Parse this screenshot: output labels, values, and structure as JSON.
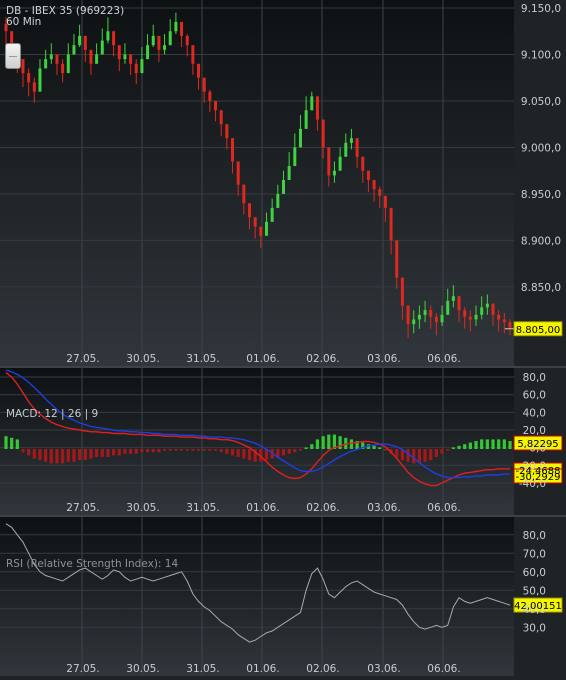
{
  "header": {
    "title": "DB - IBEX 35 (969223)",
    "interval": "60 Min"
  },
  "chart_data": [
    {
      "type": "candlestick",
      "title": "DB - IBEX 35 (969223)",
      "subtitle": "60 Min",
      "x_ticks": [
        "27.05.",
        "30.05.",
        "31.05.",
        "01.06.",
        "02.06.",
        "03.06.",
        "06.06."
      ],
      "y_ticks": [
        "9.150,0",
        "9.100,0",
        "9.050,0",
        "9.000,0",
        "8.950,0",
        "8.900,0",
        "8.850,0"
      ],
      "ylim": [
        8780,
        9150
      ],
      "last_value_label": "8.805,00",
      "last_value": 8805,
      "up_color": "#3fd33f",
      "down_color": "#e0281e",
      "close": [
        9125,
        9110,
        9095,
        9080,
        9070,
        9060,
        9085,
        9095,
        9100,
        9090,
        9080,
        9100,
        9110,
        9120,
        9105,
        9090,
        9100,
        9115,
        9125,
        9110,
        9095,
        9100,
        9090,
        9080,
        9095,
        9110,
        9120,
        9105,
        9110,
        9125,
        9135,
        9120,
        9110,
        9090,
        9075,
        9060,
        9050,
        9040,
        9025,
        9010,
        8985,
        8960,
        8940,
        8925,
        8915,
        8905,
        8920,
        8935,
        8950,
        8965,
        8980,
        9000,
        9020,
        9040,
        9055,
        9030,
        9000,
        8970,
        8975,
        8990,
        9005,
        9010,
        8990,
        8975,
        8965,
        8955,
        8948,
        8935,
        8900,
        8860,
        8830,
        8810,
        8815,
        8820,
        8825,
        8818,
        8812,
        8820,
        8835,
        8840,
        8825,
        8818,
        8815,
        8820,
        8828,
        8832,
        8820,
        8815,
        8812,
        8806
      ],
      "wick_high": [
        9140,
        9125,
        9110,
        9095,
        9085,
        9075,
        9095,
        9105,
        9112,
        9100,
        9095,
        9112,
        9122,
        9132,
        9118,
        9100,
        9112,
        9128,
        9140,
        9122,
        9108,
        9112,
        9100,
        9095,
        9108,
        9122,
        9132,
        9118,
        9122,
        9138,
        9145,
        9132,
        9122,
        9100,
        9085,
        9072,
        9062,
        9050,
        9035,
        9020,
        8995,
        8970,
        8950,
        8932,
        8922,
        8915,
        8930,
        8945,
        8960,
        8975,
        8995,
        9015,
        9035,
        9055,
        9060,
        9040,
        9012,
        8982,
        8985,
        9000,
        9015,
        9020,
        9002,
        8985,
        8975,
        8965,
        8958,
        8945,
        8910,
        8870,
        8842,
        8822,
        8825,
        8830,
        8835,
        8830,
        8822,
        8830,
        8848,
        8852,
        8838,
        8828,
        8825,
        8830,
        8840,
        8842,
        8830,
        8825,
        8822,
        8815
      ],
      "wick_low": [
        9108,
        9095,
        9080,
        9065,
        9055,
        9048,
        9070,
        9085,
        9090,
        9078,
        9070,
        9088,
        9100,
        9108,
        9092,
        9078,
        9090,
        9102,
        9112,
        9098,
        9082,
        9090,
        9078,
        9068,
        9082,
        9098,
        9108,
        9092,
        9100,
        9112,
        9122,
        9108,
        9098,
        9078,
        9062,
        9048,
        9038,
        9028,
        9012,
        8998,
        8972,
        8948,
        8928,
        8912,
        8902,
        8892,
        8908,
        8925,
        8940,
        8955,
        8970,
        8988,
        9008,
        9028,
        9042,
        9018,
        8988,
        8958,
        8962,
        8978,
        8992,
        8998,
        8978,
        8962,
        8952,
        8942,
        8935,
        8920,
        8885,
        8848,
        8815,
        8795,
        8800,
        8805,
        8812,
        8805,
        8798,
        8808,
        8822,
        8828,
        8812,
        8805,
        8802,
        8808,
        8815,
        8820,
        8808,
        8802,
        8800,
        8798
      ]
    },
    {
      "type": "line",
      "title": "MACD: 12 | 26 | 9",
      "y_ticks": [
        "80,0",
        "60,0",
        "40,0",
        "20,0",
        "0,0",
        "-20,0",
        "-40,0"
      ],
      "ylim": [
        -48,
        88
      ],
      "value_labels": [
        "5,82295",
        "-24,4688",
        "-30,2929"
      ],
      "series": [
        {
          "color": "#e02020",
          "values": [
            85,
            80,
            72,
            62,
            52,
            44,
            38,
            33,
            29,
            26,
            24,
            22,
            21,
            20,
            19,
            18,
            18,
            17,
            17,
            16,
            16,
            16,
            15,
            15,
            15,
            14,
            14,
            14,
            13,
            13,
            13,
            12,
            12,
            12,
            11,
            11,
            10,
            10,
            9,
            9,
            8,
            6,
            3,
            0,
            -5,
            -10,
            -16,
            -22,
            -27,
            -31,
            -34,
            -35,
            -34,
            -30,
            -24,
            -16,
            -9,
            -3,
            0,
            2,
            4,
            5,
            6,
            7,
            7,
            6,
            4,
            1,
            -5,
            -12,
            -20,
            -28,
            -34,
            -38,
            -41,
            -43,
            -43,
            -40,
            -37,
            -34,
            -31,
            -29,
            -28,
            -27,
            -26,
            -25,
            -25,
            -24,
            -24,
            -24
          ]
        },
        {
          "color": "#1e3ee0",
          "values": [
            88,
            86,
            83,
            79,
            74,
            68,
            62,
            55,
            49,
            43,
            38,
            34,
            31,
            28,
            26,
            24,
            23,
            22,
            21,
            20,
            19,
            19,
            18,
            18,
            17,
            17,
            16,
            16,
            15,
            15,
            15,
            14,
            14,
            14,
            13,
            13,
            12,
            12,
            12,
            11,
            11,
            10,
            9,
            7,
            5,
            2,
            -2,
            -6,
            -11,
            -15,
            -19,
            -23,
            -26,
            -27,
            -27,
            -25,
            -22,
            -18,
            -14,
            -10,
            -7,
            -4,
            -2,
            0,
            2,
            3,
            4,
            4,
            3,
            1,
            -2,
            -7,
            -12,
            -17,
            -22,
            -26,
            -30,
            -32,
            -34,
            -34,
            -34,
            -33,
            -33,
            -32,
            -32,
            -31,
            -31,
            -31,
            -30,
            -30
          ]
        }
      ],
      "histogram": {
        "up_color": "#34c934",
        "down_color": "#a91818",
        "values": [
          8,
          7,
          6,
          -2,
          -4,
          -6,
          -7,
          -8,
          -9,
          -9,
          -9,
          -8,
          -8,
          -7,
          -7,
          -6,
          -5,
          -5,
          -5,
          -4,
          -4,
          -3,
          -3,
          -3,
          -2,
          -2,
          -2,
          -2,
          -1,
          -1,
          -1,
          -1,
          -1,
          -1,
          -1,
          -1,
          -1,
          -1,
          -2,
          -3,
          -4,
          -5,
          -6,
          -7,
          -8,
          -8,
          -7,
          -6,
          -5,
          -4,
          -3,
          -2,
          -1,
          1,
          3,
          6,
          8,
          9,
          9,
          8,
          7,
          6,
          5,
          4,
          3,
          2,
          1,
          -1,
          -3,
          -5,
          -7,
          -8,
          -9,
          -9,
          -8,
          -7,
          -5,
          -3,
          -1,
          1,
          2,
          3,
          4,
          5,
          6,
          6,
          6,
          6,
          6,
          5
        ]
      }
    },
    {
      "type": "line",
      "title": "RSI (Relative Strength Index): 14",
      "y_ticks": [
        "80,0",
        "70,0",
        "60,0",
        "50,0",
        "40,0",
        "30,0"
      ],
      "ylim": [
        15,
        88
      ],
      "last_value_label": "42,00151",
      "series": [
        {
          "color": "#a8acaf",
          "values": [
            86,
            84,
            80,
            76,
            70,
            64,
            60,
            58,
            57,
            56,
            55,
            57,
            59,
            61,
            62,
            60,
            58,
            56,
            58,
            61,
            60,
            57,
            55,
            56,
            57,
            56,
            55,
            56,
            57,
            58,
            59,
            60,
            55,
            48,
            44,
            41,
            39,
            36,
            33,
            31,
            29,
            26,
            24,
            22,
            23,
            25,
            27,
            28,
            30,
            32,
            34,
            36,
            38,
            50,
            59,
            62,
            56,
            48,
            46,
            49,
            52,
            54,
            55,
            53,
            51,
            49,
            48,
            47,
            46,
            45,
            42,
            37,
            33,
            30,
            29,
            30,
            31,
            30,
            31,
            41,
            46,
            44,
            43,
            44,
            45,
            46,
            45,
            44,
            43,
            42
          ]
        }
      ]
    }
  ]
}
